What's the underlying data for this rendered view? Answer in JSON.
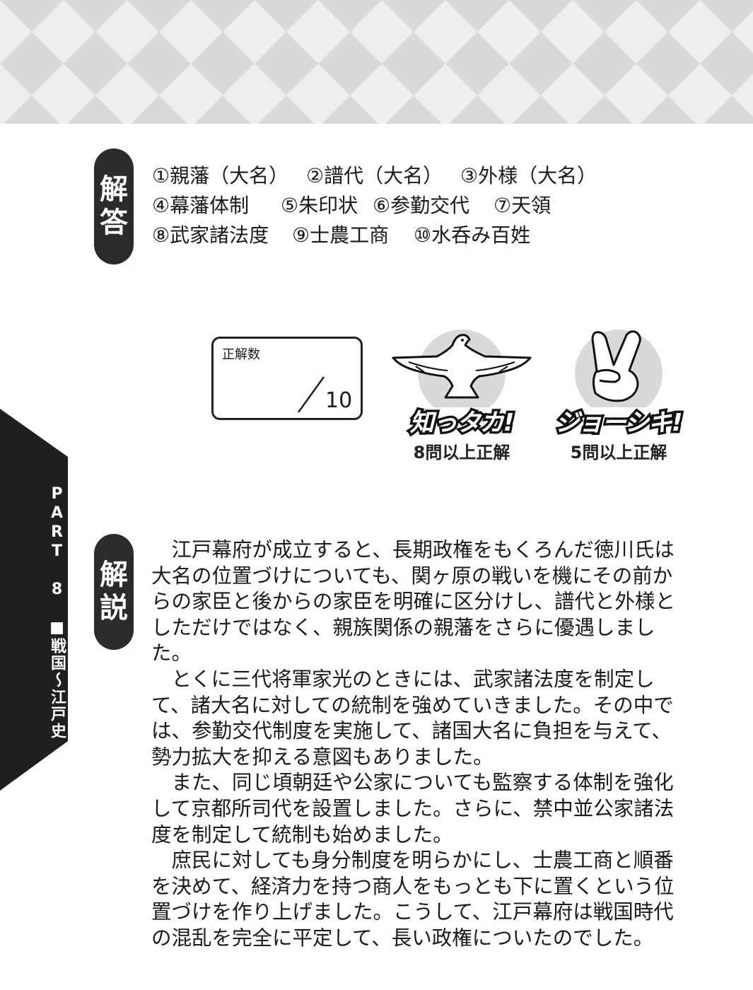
{
  "answer_tag": [
    "解",
    "答"
  ],
  "answers": {
    "row1": [
      "①親藩（大名）",
      "②譜代（大名）",
      "③外様（大名）"
    ],
    "row2": [
      "④幕藩体制",
      "⑤朱印状",
      "⑥参勤交代",
      "⑦天領"
    ],
    "row3": [
      "⑧武家諸法度",
      "⑨士農工商",
      "⑩水呑み百姓"
    ]
  },
  "score": {
    "label": "正解数",
    "total": "10"
  },
  "badges": [
    {
      "icon": "hawk-icon",
      "title": "知っタカ!",
      "condition": "8問以上正解"
    },
    {
      "icon": "peace-sign-icon",
      "title": "ジョーシキ!",
      "condition": "5問以上正解"
    }
  ],
  "side_tab": {
    "text": "PART 8 ■戦国〜江戸史"
  },
  "explain_tag": [
    "解",
    "説"
  ],
  "explanation": [
    "江戸幕府が成立すると、長期政権をもくろんだ徳川氏は大名の位置づけについても、関ヶ原の戦いを機にその前からの家臣と後からの家臣を明確に区分けし、譜代と外様としただけではなく、親族関係の親藩をさらに優遇しました。",
    "とくに三代将軍家光のときには、武家諸法度を制定して、諸大名に対しての統制を強めていきました。その中では、参勤交代制度を実施して、諸国大名に負担を与えて、勢力拡大を抑える意図もありました。",
    "また、同じ頃朝廷や公家についても監察する体制を強化して京都所司代を設置しました。さらに、禁中並公家諸法度を制定して統制も始めました。",
    "庶民に対しても身分制度を明らかにし、士農工商と順番を決めて、経済力を持つ商人をもっとも下に置くという位置づけを作り上げました。こうして、江戸幕府は戦国時代の混乱を完全に平定して、長い政権についたのでした。"
  ]
}
